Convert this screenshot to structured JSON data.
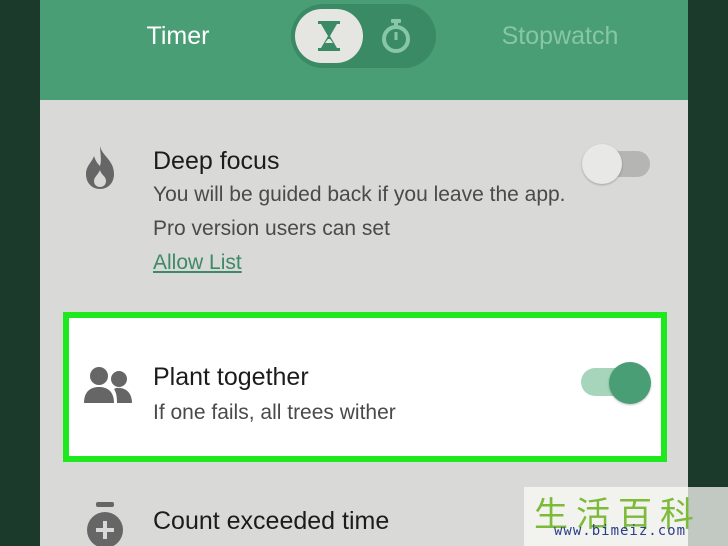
{
  "header": {
    "tabs": {
      "timer": "Timer",
      "stopwatch": "Stopwatch"
    },
    "mode_toggle": {
      "selected": "hourglass-icon",
      "other": "stopwatch-icon"
    }
  },
  "settings": {
    "deep_focus": {
      "icon": "flame-icon",
      "title": "Deep focus",
      "description": "You will be guided back if you leave the app. Pro version users can set",
      "link": "Allow List",
      "enabled": false
    },
    "plant_together": {
      "icon": "people-icon",
      "title": "Plant together",
      "description": "If one fails, all trees wither",
      "enabled": true,
      "highlighted": true
    },
    "count_exceeded": {
      "icon": "timer-plus-icon",
      "title": "Count exceeded time"
    }
  },
  "watermark": {
    "chars": "生活百科",
    "url": "www.bimeiz.com"
  },
  "colors": {
    "header": "#4a9e76",
    "background": "#d9d9d7",
    "highlight_border": "#1ee91e",
    "toggle_on": "#4a9e76",
    "link": "#3e8a67"
  }
}
